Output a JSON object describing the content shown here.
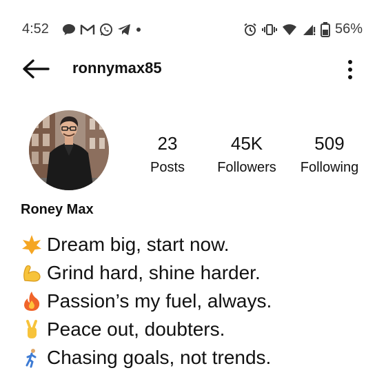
{
  "status_bar": {
    "time": "4:52",
    "battery_percent": "56%",
    "left_icons": [
      "chat-bubble-icon",
      "gmail-icon",
      "whatsapp-icon",
      "telegram-icon",
      "dot-icon"
    ],
    "right_icons": [
      "alarm-icon",
      "vibrate-icon",
      "wifi-icon",
      "signal-icon",
      "battery-icon"
    ]
  },
  "header": {
    "username": "ronnymax85",
    "back_icon": "back-arrow-icon",
    "menu_icon": "more-vertical-icon"
  },
  "profile": {
    "name": "Roney Max",
    "stats": {
      "posts": {
        "value": "23",
        "label": "Posts"
      },
      "followers": {
        "value": "45K",
        "label": "Followers"
      },
      "following": {
        "value": "509",
        "label": "Following"
      }
    },
    "bio": [
      {
        "icon": "star-emoji-icon",
        "text": "Dream big, start now."
      },
      {
        "icon": "flexed-biceps-emoji-icon",
        "text": "Grind hard, shine harder."
      },
      {
        "icon": "fire-emoji-icon",
        "text": "Passion’s my fuel, always."
      },
      {
        "icon": "victory-hand-emoji-icon",
        "text": "Peace out, doubters."
      },
      {
        "icon": "person-running-emoji-icon",
        "text": "Chasing goals, not trends."
      }
    ]
  },
  "colors": {
    "text": "#111111",
    "status_text": "#3a3a3a",
    "background": "#ffffff",
    "star": "#f5a623",
    "biceps": "#f7c33b",
    "fire": "#f0642a"
  }
}
